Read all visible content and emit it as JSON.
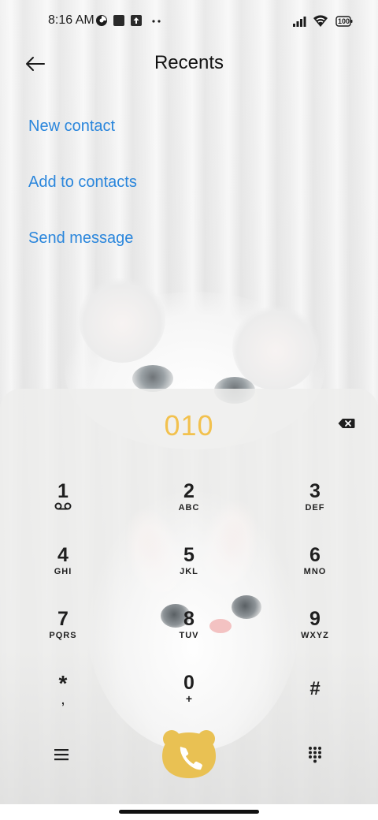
{
  "status_bar": {
    "time": "8:16 AM",
    "battery": "100",
    "icons": [
      "data-saver-icon",
      "square-notification-icon",
      "upload-icon",
      "more-dots-icon",
      "signal-icon",
      "wifi-icon",
      "battery-icon"
    ]
  },
  "header": {
    "title": "Recents",
    "back_icon": "arrow-left-icon"
  },
  "actions": {
    "new_contact": "New contact",
    "add_to_contacts": "Add to contacts",
    "send_message": "Send message"
  },
  "dialer": {
    "number": "010",
    "keys": [
      {
        "digit": "1",
        "letters": "",
        "extra_icon": "voicemail-icon"
      },
      {
        "digit": "2",
        "letters": "ABC"
      },
      {
        "digit": "3",
        "letters": "DEF"
      },
      {
        "digit": "4",
        "letters": "GHI"
      },
      {
        "digit": "5",
        "letters": "JKL"
      },
      {
        "digit": "6",
        "letters": "MNO"
      },
      {
        "digit": "7",
        "letters": "PQRS"
      },
      {
        "digit": "8",
        "letters": "TUV"
      },
      {
        "digit": "9",
        "letters": "WXYZ"
      },
      {
        "digit": "*",
        "letters": ","
      },
      {
        "digit": "0",
        "letters": "+"
      },
      {
        "digit": "#",
        "letters": ""
      }
    ],
    "bottom_icons": [
      "menu-icon",
      "phone-call-icon",
      "keypad-icon"
    ]
  },
  "colors": {
    "accent_blue": "#2a86dc",
    "number_yellow": "#f2c14e",
    "call_button": "#e9c153"
  }
}
